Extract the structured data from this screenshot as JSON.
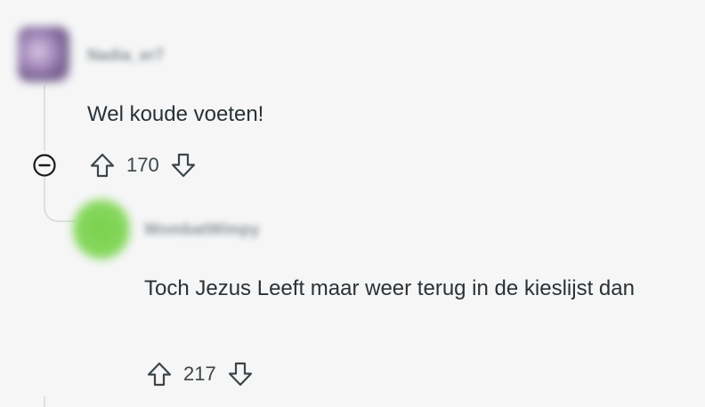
{
  "comments": [
    {
      "username": "Nadia_er7",
      "body": "Wel koude voeten!",
      "score": "170",
      "avatar_color": "#9b7fb3"
    },
    {
      "username": "WombatWimpy",
      "body": "Toch Jezus Leeft maar weer terug in de kieslijst dan",
      "score": "217",
      "avatar_color": "#7bd14e"
    }
  ],
  "icons": {
    "upvote": "arrow-up-outline-icon",
    "downvote": "arrow-down-outline-icon",
    "collapse": "minus-circle-icon"
  },
  "colors": {
    "background": "#f6f6f7",
    "text": "#2a3236",
    "thread_line": "#dcdfe2"
  }
}
